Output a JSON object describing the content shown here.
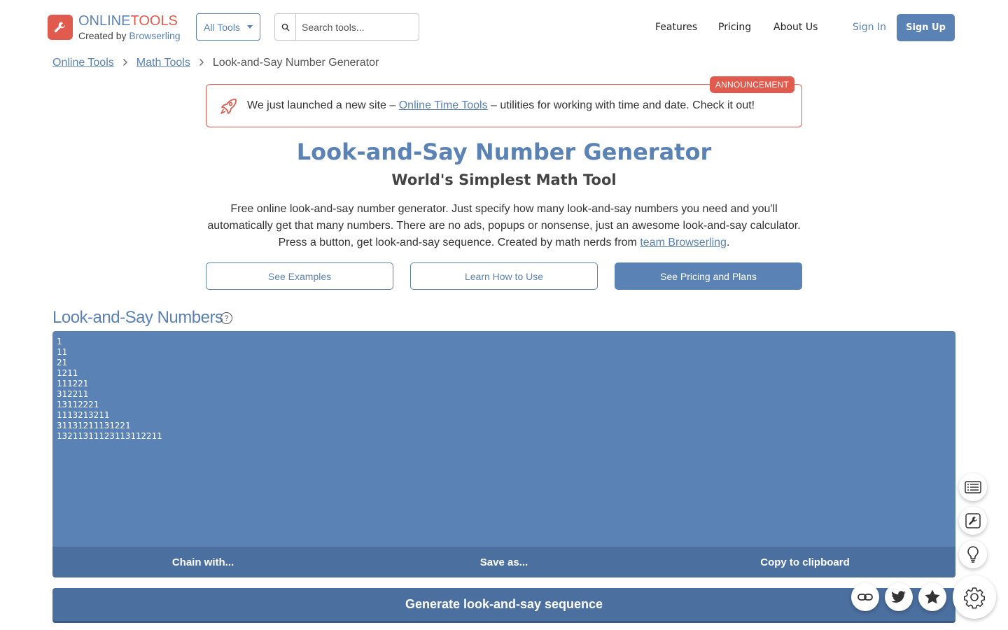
{
  "brand": {
    "name_part1": "ONLINE",
    "name_part2": "TOOLS",
    "created_by_prefix": "Created by ",
    "created_by_brand": "Browserling",
    "accent": "#5a82b5",
    "logo_color": "#e15a4e"
  },
  "header": {
    "all_tools_label": "All Tools",
    "search_placeholder": "Search tools...",
    "nav": [
      "Features",
      "Pricing",
      "About Us"
    ],
    "sign_in": "Sign In",
    "sign_up": "Sign Up"
  },
  "breadcrumb": {
    "items": [
      "Online Tools",
      "Math Tools"
    ],
    "current": "Look-and-Say Number Generator"
  },
  "announcement": {
    "badge": "ANNOUNCEMENT",
    "text_before": "We just launched a new site – ",
    "link_text": "Online Time Tools",
    "text_after": " – utilities for working with time and date. Check it out!"
  },
  "page": {
    "title": "Look-and-Say Number Generator",
    "subtitle": "World's Simplest Math Tool",
    "description_part1": "Free online look-and-say number generator. Just specify how many look-and-say numbers you need and you'll automatically get that many numbers. There are no ads, popups or nonsense, just an awesome look-and-say calculator. Press a button, get look-and-say sequence. Created by math nerds from ",
    "description_link": "team Browserling",
    "description_end": ".",
    "buttons": {
      "examples": "See Examples",
      "learn": "Learn How to Use",
      "pricing": "See Pricing and Plans"
    }
  },
  "tool": {
    "heading": "Look-and-Say Numbers",
    "help_glyph": "?",
    "output_lines": [
      "1",
      "11",
      "21",
      "1211",
      "111221",
      "312211",
      "13112221",
      "1113213211",
      "31131211131221",
      "13211311123113112211"
    ],
    "actions": {
      "chain": "Chain with...",
      "save": "Save as...",
      "copy": "Copy to clipboard"
    },
    "generate": "Generate look-and-say sequence"
  },
  "floating_icons": [
    "list-icon",
    "wrench-icon",
    "lightbulb-icon",
    "link-icon",
    "twitter-icon",
    "star-icon",
    "gear-icon"
  ]
}
